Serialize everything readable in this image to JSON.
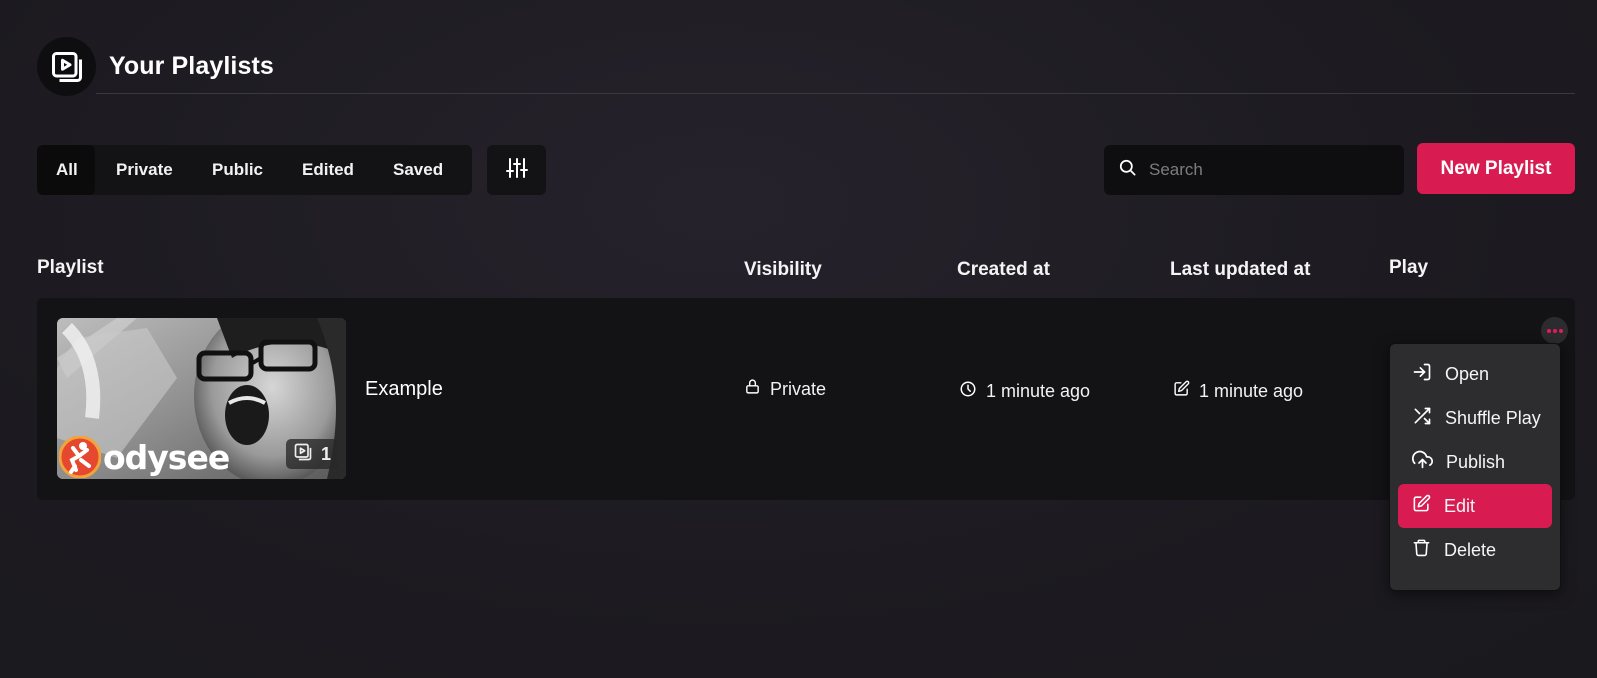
{
  "header": {
    "title": "Your Playlists",
    "icon": "playlist-icon"
  },
  "filters": {
    "tabs": [
      {
        "label": "All",
        "active": true
      },
      {
        "label": "Private",
        "active": false
      },
      {
        "label": "Public",
        "active": false
      },
      {
        "label": "Edited",
        "active": false
      },
      {
        "label": "Saved",
        "active": false
      }
    ],
    "filter_icon": "sliders-icon"
  },
  "search": {
    "placeholder": "Search",
    "value": ""
  },
  "new_playlist_label": "New Playlist",
  "table": {
    "columns": {
      "playlist": "Playlist",
      "visibility": "Visibility",
      "created": "Created at",
      "updated": "Last updated at",
      "play": "Play"
    },
    "rows": [
      {
        "title": "Example",
        "thumbnail_count": "1",
        "thumbnail_logo_text": "odysee",
        "visibility": "Private",
        "created": "1 minute ago",
        "updated": "1 minute ago"
      }
    ]
  },
  "menu": {
    "items": [
      {
        "label": "Open",
        "icon": "open-icon"
      },
      {
        "label": "Shuffle Play",
        "icon": "shuffle-icon"
      },
      {
        "label": "Publish",
        "icon": "cloud-upload-icon"
      },
      {
        "label": "Edit",
        "icon": "edit-icon",
        "highlighted": true
      },
      {
        "label": "Delete",
        "icon": "trash-icon"
      }
    ]
  },
  "colors": {
    "accent": "#d81b50",
    "background": "#1d1b21",
    "surface": "#131215",
    "menu": "#2d2c2f"
  }
}
